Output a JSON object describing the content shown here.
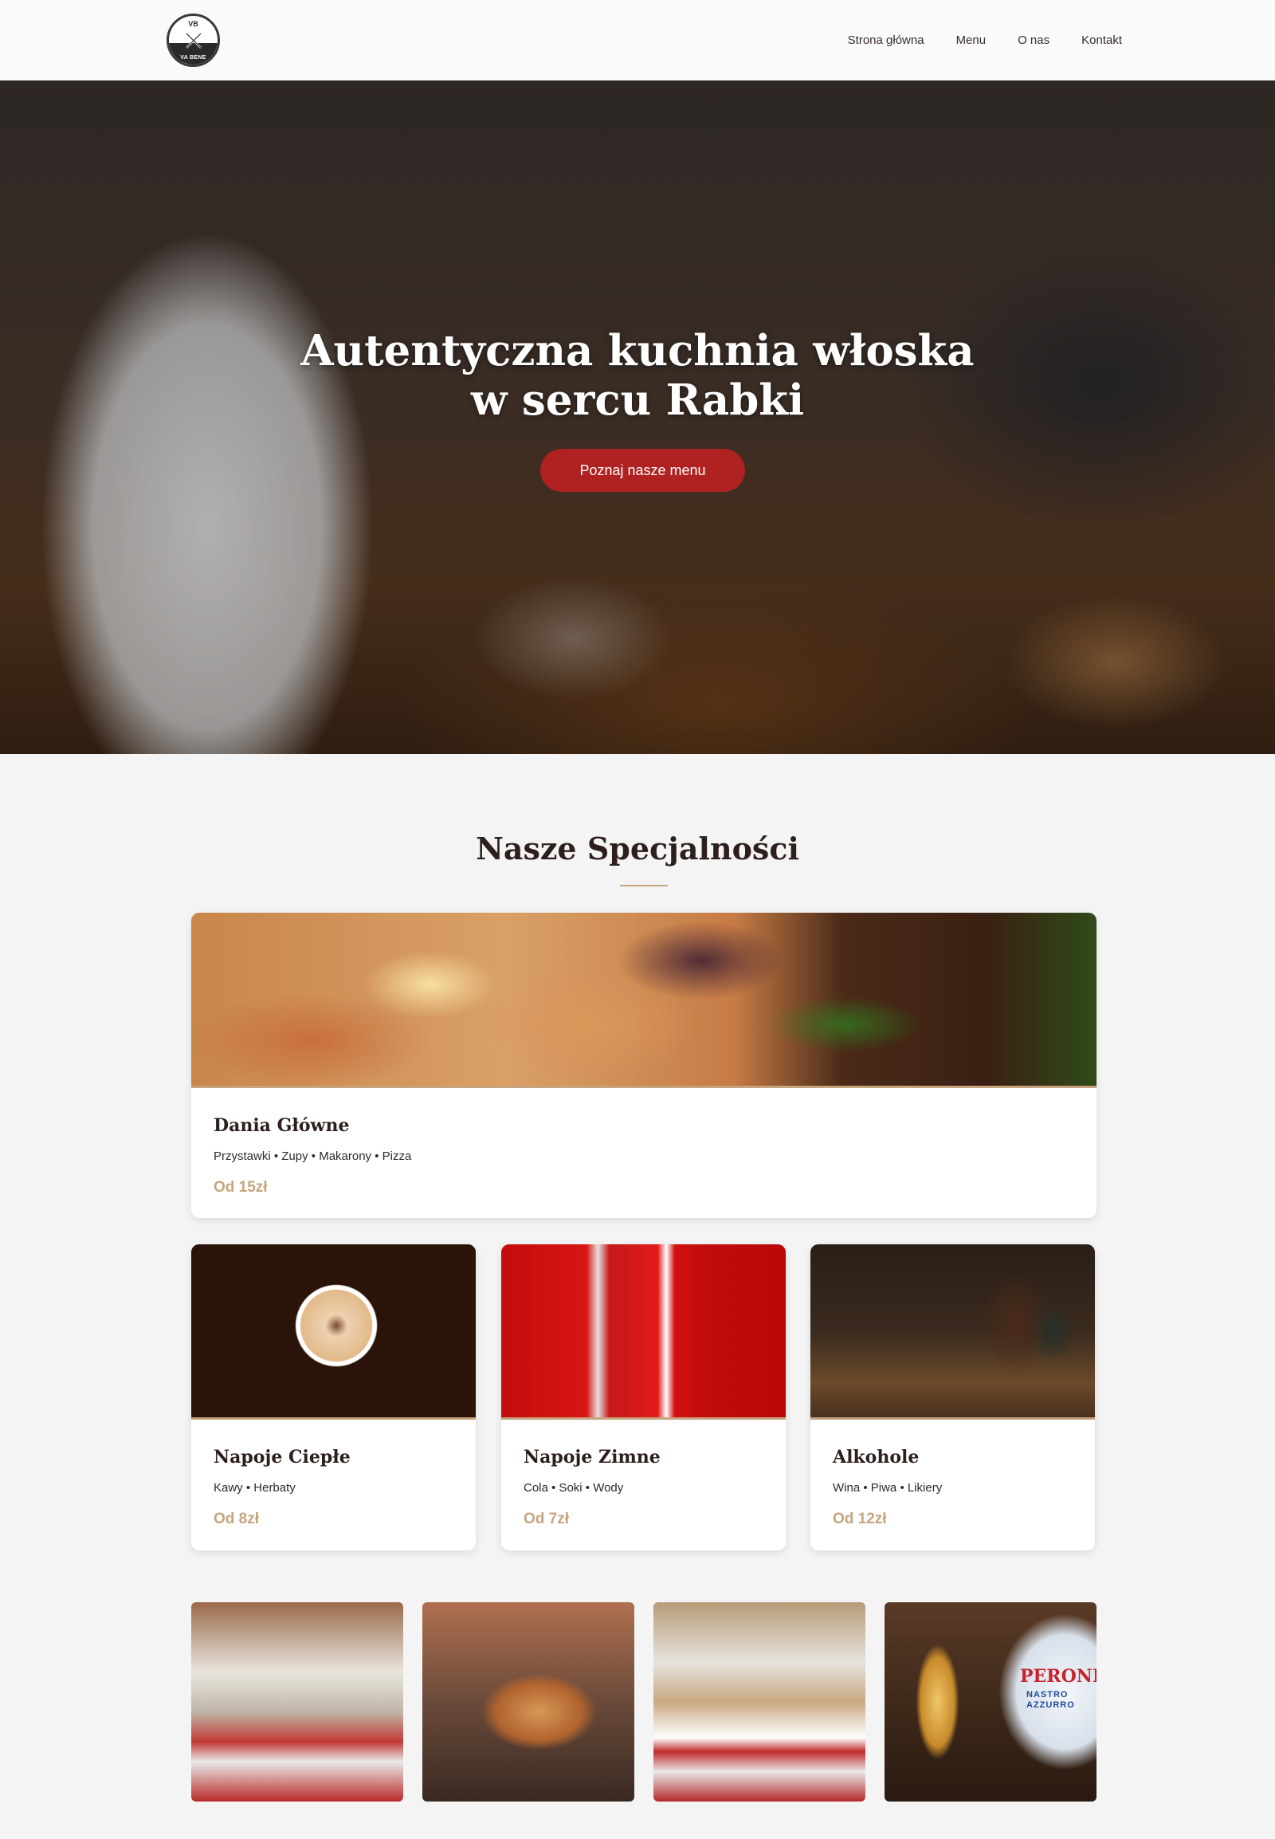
{
  "header": {
    "logo_top": "VB",
    "logo_bottom": "VA BENE",
    "nav": [
      "Strona główna",
      "Menu",
      "O nas",
      "Kontakt"
    ]
  },
  "hero": {
    "title_line1": "Autentyczna kuchnia włoska",
    "title_line2": "w sercu Rabki",
    "button_label": "Poznaj nasze menu"
  },
  "specials": {
    "title": "Nasze Specjalności",
    "main_card": {
      "title": "Dania Główne",
      "description": "Przystawki • Zupy • Makarony • Pizza",
      "price": "Od 15zł"
    },
    "cards": [
      {
        "title": "Napoje Ciepłe",
        "description": "Kawy • Herbaty",
        "price": "Od 8zł"
      },
      {
        "title": "Napoje Zimne",
        "description": "Cola • Soki • Wody",
        "price": "Od 7zł"
      },
      {
        "title": "Alkohole",
        "description": "Wina • Piwa • Likiery",
        "price": "Od 12zł"
      }
    ]
  },
  "gallery": {
    "beer_tap_brand": "PERONI",
    "beer_tap_sub": "NASTRO AZZURRO"
  },
  "colors": {
    "accent_gold": "#c5a47e",
    "button_red": "#b02121",
    "heading_dark": "#2d1f1b"
  }
}
